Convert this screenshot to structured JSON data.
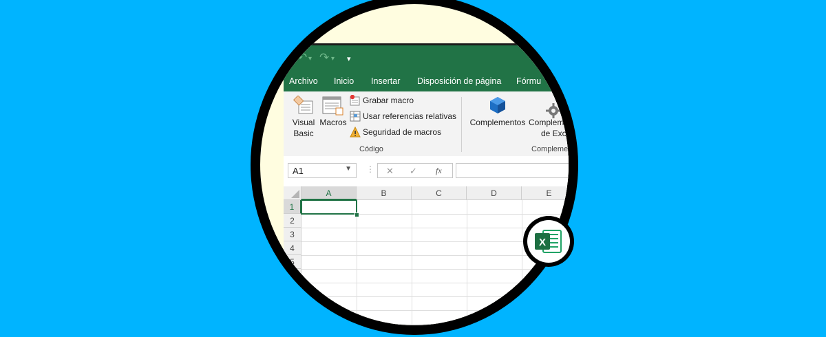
{
  "colors": {
    "background": "#00b4ff",
    "excel_green": "#217346",
    "ribbon": "#f3f3f3"
  },
  "menu": {
    "tabs": [
      "Archivo",
      "Inicio",
      "Insertar",
      "Disposición de página",
      "Fórmu"
    ]
  },
  "ribbon": {
    "visual_basic_line1": "Visual",
    "visual_basic_line2": "Basic",
    "macros": "Macros",
    "record_macro": "Grabar macro",
    "relative_refs": "Usar referencias relativas",
    "macro_security": "Seguridad de macros",
    "code_group": "Código",
    "complements": "Complementos",
    "excel_complements_line1": "Complem",
    "excel_complements_line2": "de Exc",
    "complements_group": "Compleme"
  },
  "formula_bar": {
    "name_box": "A1",
    "cancel": "✕",
    "enter": "✓",
    "fx": "fx"
  },
  "grid": {
    "columns": [
      "A",
      "B",
      "C",
      "D",
      "E"
    ],
    "rows": [
      "1",
      "2",
      "3",
      "4",
      "5"
    ],
    "selected_cell": "A1"
  }
}
